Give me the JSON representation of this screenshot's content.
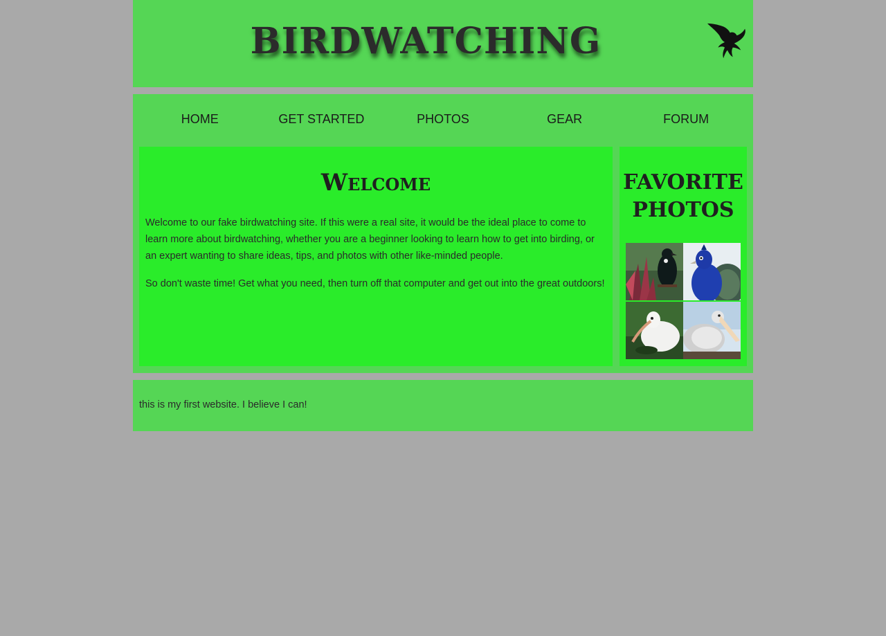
{
  "header": {
    "title": "BIRDWATCHING",
    "logo_icon": "bird-silhouette-icon"
  },
  "nav": {
    "items": [
      {
        "label": "HOME"
      },
      {
        "label": "GET STARTED"
      },
      {
        "label": "PHOTOS"
      },
      {
        "label": "GEAR"
      },
      {
        "label": "FORUM"
      }
    ]
  },
  "main": {
    "heading": "Welcome",
    "paragraphs": [
      "Welcome to our fake birdwatching site. If this were a real site, it would be the ideal place to come to learn more about birdwatching, whether you are a beginner looking to learn how to get into birding, or an expert wanting to share ideas, tips, and photos with other like-minded people.",
      "So don't waste time! Get what you need, then turn off that computer and get out into the great outdoors!"
    ]
  },
  "sidebar": {
    "heading": "FAVORITE PHOTOS",
    "photos": [
      {
        "subject": "tui"
      },
      {
        "subject": "peacock"
      },
      {
        "subject": "ibis"
      },
      {
        "subject": "pelican"
      }
    ]
  },
  "footer": {
    "text": "this is my first website. I believe I can!"
  },
  "colors": {
    "page_background": "#a9a9a9",
    "section_background": "#55d655",
    "panel_background": "#2aec2a",
    "text": "#222222"
  }
}
